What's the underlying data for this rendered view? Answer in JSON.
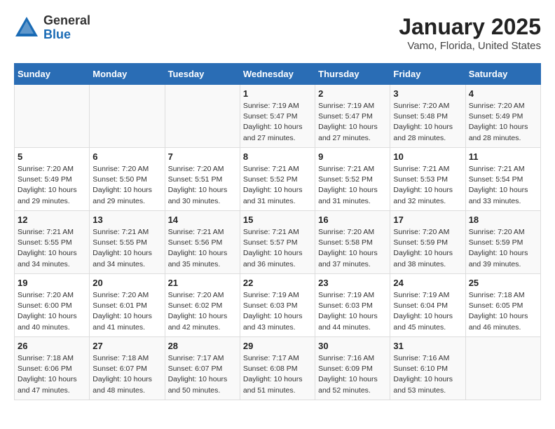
{
  "header": {
    "logo_general": "General",
    "logo_blue": "Blue",
    "title": "January 2025",
    "subtitle": "Vamo, Florida, United States"
  },
  "days_of_week": [
    "Sunday",
    "Monday",
    "Tuesday",
    "Wednesday",
    "Thursday",
    "Friday",
    "Saturday"
  ],
  "weeks": [
    [
      {
        "day": "",
        "info": ""
      },
      {
        "day": "",
        "info": ""
      },
      {
        "day": "",
        "info": ""
      },
      {
        "day": "1",
        "info": "Sunrise: 7:19 AM\nSunset: 5:47 PM\nDaylight: 10 hours\nand 27 minutes."
      },
      {
        "day": "2",
        "info": "Sunrise: 7:19 AM\nSunset: 5:47 PM\nDaylight: 10 hours\nand 27 minutes."
      },
      {
        "day": "3",
        "info": "Sunrise: 7:20 AM\nSunset: 5:48 PM\nDaylight: 10 hours\nand 28 minutes."
      },
      {
        "day": "4",
        "info": "Sunrise: 7:20 AM\nSunset: 5:49 PM\nDaylight: 10 hours\nand 28 minutes."
      }
    ],
    [
      {
        "day": "5",
        "info": "Sunrise: 7:20 AM\nSunset: 5:49 PM\nDaylight: 10 hours\nand 29 minutes."
      },
      {
        "day": "6",
        "info": "Sunrise: 7:20 AM\nSunset: 5:50 PM\nDaylight: 10 hours\nand 29 minutes."
      },
      {
        "day": "7",
        "info": "Sunrise: 7:20 AM\nSunset: 5:51 PM\nDaylight: 10 hours\nand 30 minutes."
      },
      {
        "day": "8",
        "info": "Sunrise: 7:21 AM\nSunset: 5:52 PM\nDaylight: 10 hours\nand 31 minutes."
      },
      {
        "day": "9",
        "info": "Sunrise: 7:21 AM\nSunset: 5:52 PM\nDaylight: 10 hours\nand 31 minutes."
      },
      {
        "day": "10",
        "info": "Sunrise: 7:21 AM\nSunset: 5:53 PM\nDaylight: 10 hours\nand 32 minutes."
      },
      {
        "day": "11",
        "info": "Sunrise: 7:21 AM\nSunset: 5:54 PM\nDaylight: 10 hours\nand 33 minutes."
      }
    ],
    [
      {
        "day": "12",
        "info": "Sunrise: 7:21 AM\nSunset: 5:55 PM\nDaylight: 10 hours\nand 34 minutes."
      },
      {
        "day": "13",
        "info": "Sunrise: 7:21 AM\nSunset: 5:55 PM\nDaylight: 10 hours\nand 34 minutes."
      },
      {
        "day": "14",
        "info": "Sunrise: 7:21 AM\nSunset: 5:56 PM\nDaylight: 10 hours\nand 35 minutes."
      },
      {
        "day": "15",
        "info": "Sunrise: 7:21 AM\nSunset: 5:57 PM\nDaylight: 10 hours\nand 36 minutes."
      },
      {
        "day": "16",
        "info": "Sunrise: 7:20 AM\nSunset: 5:58 PM\nDaylight: 10 hours\nand 37 minutes."
      },
      {
        "day": "17",
        "info": "Sunrise: 7:20 AM\nSunset: 5:59 PM\nDaylight: 10 hours\nand 38 minutes."
      },
      {
        "day": "18",
        "info": "Sunrise: 7:20 AM\nSunset: 5:59 PM\nDaylight: 10 hours\nand 39 minutes."
      }
    ],
    [
      {
        "day": "19",
        "info": "Sunrise: 7:20 AM\nSunset: 6:00 PM\nDaylight: 10 hours\nand 40 minutes."
      },
      {
        "day": "20",
        "info": "Sunrise: 7:20 AM\nSunset: 6:01 PM\nDaylight: 10 hours\nand 41 minutes."
      },
      {
        "day": "21",
        "info": "Sunrise: 7:20 AM\nSunset: 6:02 PM\nDaylight: 10 hours\nand 42 minutes."
      },
      {
        "day": "22",
        "info": "Sunrise: 7:19 AM\nSunset: 6:03 PM\nDaylight: 10 hours\nand 43 minutes."
      },
      {
        "day": "23",
        "info": "Sunrise: 7:19 AM\nSunset: 6:03 PM\nDaylight: 10 hours\nand 44 minutes."
      },
      {
        "day": "24",
        "info": "Sunrise: 7:19 AM\nSunset: 6:04 PM\nDaylight: 10 hours\nand 45 minutes."
      },
      {
        "day": "25",
        "info": "Sunrise: 7:18 AM\nSunset: 6:05 PM\nDaylight: 10 hours\nand 46 minutes."
      }
    ],
    [
      {
        "day": "26",
        "info": "Sunrise: 7:18 AM\nSunset: 6:06 PM\nDaylight: 10 hours\nand 47 minutes."
      },
      {
        "day": "27",
        "info": "Sunrise: 7:18 AM\nSunset: 6:07 PM\nDaylight: 10 hours\nand 48 minutes."
      },
      {
        "day": "28",
        "info": "Sunrise: 7:17 AM\nSunset: 6:07 PM\nDaylight: 10 hours\nand 50 minutes."
      },
      {
        "day": "29",
        "info": "Sunrise: 7:17 AM\nSunset: 6:08 PM\nDaylight: 10 hours\nand 51 minutes."
      },
      {
        "day": "30",
        "info": "Sunrise: 7:16 AM\nSunset: 6:09 PM\nDaylight: 10 hours\nand 52 minutes."
      },
      {
        "day": "31",
        "info": "Sunrise: 7:16 AM\nSunset: 6:10 PM\nDaylight: 10 hours\nand 53 minutes."
      },
      {
        "day": "",
        "info": ""
      }
    ]
  ]
}
